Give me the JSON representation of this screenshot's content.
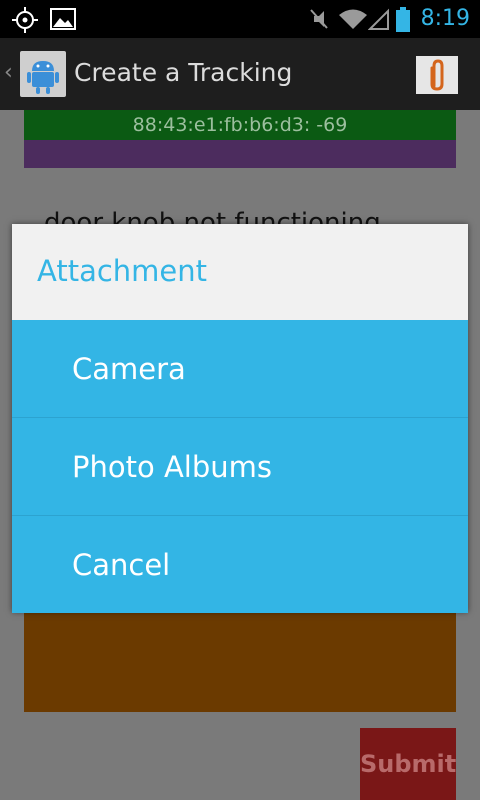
{
  "status_bar": {
    "time": "8:19",
    "icons": [
      "gps-icon",
      "image-icon",
      "mute-icon",
      "wifi-icon",
      "signal-icon",
      "battery-icon"
    ]
  },
  "action_bar": {
    "title": "Create a Tracking"
  },
  "background": {
    "mac_reading": "88:43:e1:fb:b6:d3: -69",
    "description_text": "door knob not functioning",
    "submit_label": "Submit"
  },
  "dialog": {
    "title": "Attachment",
    "items": [
      {
        "label": "Camera"
      },
      {
        "label": "Photo Albums"
      },
      {
        "label": "Cancel"
      }
    ]
  },
  "colors": {
    "accent": "#33b5e5",
    "green_bar": "#0b5a13",
    "purple_bar": "#4c2c5e",
    "orange_box": "#6b3a00",
    "submit": "#7a1717"
  }
}
